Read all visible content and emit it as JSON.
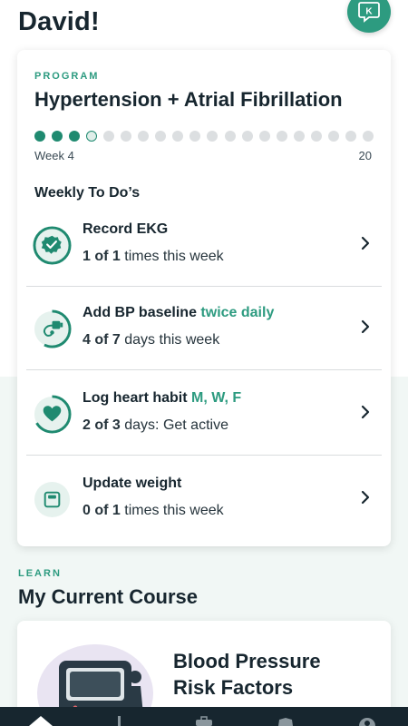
{
  "header": {
    "greeting": "David!",
    "avatar_letter": "K"
  },
  "program": {
    "eyebrow": "PROGRAM",
    "title": "Hypertension + Atrial Fibrillation",
    "current_week": 4,
    "total_weeks": 20,
    "week_label": "Week 4",
    "end_label": "20"
  },
  "todos": {
    "heading": "Weekly To Do’s",
    "items": [
      {
        "title": "Record EKG",
        "title_accent": "",
        "count": "1 of 1",
        "sub": "times this week",
        "icon": "check-badge-icon",
        "progress": 1.0
      },
      {
        "title": "Add BP baseline",
        "title_accent": "twice daily",
        "count": "4 of 7",
        "sub": "days this week",
        "icon": "bp-cuff-icon",
        "progress": 0.5714
      },
      {
        "title": "Log heart habit",
        "title_accent": "M, W, F",
        "count": "2 of 3",
        "sub": "days: Get active",
        "icon": "heart-icon",
        "progress": 0.6667
      },
      {
        "title": "Update weight",
        "title_accent": "",
        "count": "0 of 1",
        "sub": "times this week",
        "icon": "scale-icon",
        "progress": 0.0
      }
    ]
  },
  "learn": {
    "eyebrow": "LEARN",
    "heading": "My Current Course",
    "course_title": "Blood Pressure Risk Factors",
    "course_title_line1": "Blood Pressure",
    "course_title_line2": "Risk Factors"
  },
  "nav": {
    "items": [
      "home-icon",
      "stats-icon",
      "briefcase-icon",
      "badge-icon",
      "profile-icon"
    ]
  },
  "colors": {
    "accent": "#2d9b80",
    "dark": "#17262f"
  }
}
